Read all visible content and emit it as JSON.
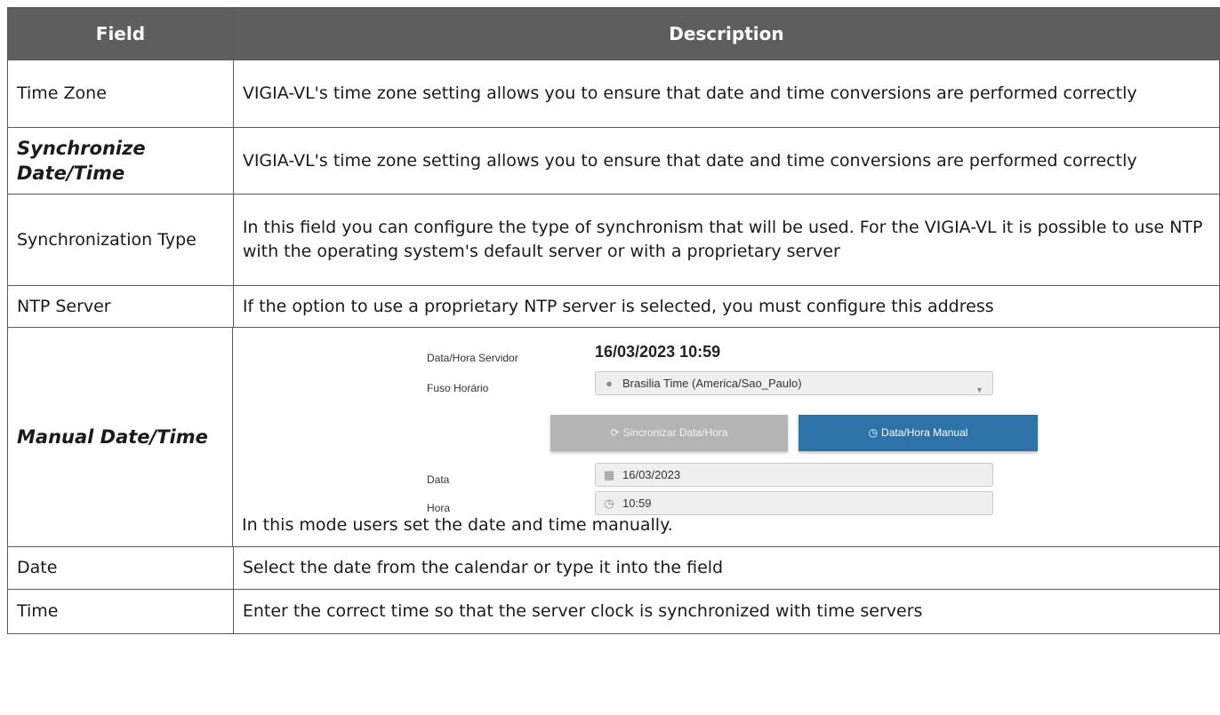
{
  "header": {
    "field": "Field",
    "description": "Description"
  },
  "rows": [
    {
      "field": "Time Zone",
      "description": "VIGIA-VL's time zone setting allows you to ensure that date and time conversions are performed correctly"
    },
    {
      "field": "Synchronize Date/Time",
      "description": "VIGIA-VL's time zone setting allows you to ensure that date and time conversions are performed correctly"
    },
    {
      "field": "Synchronization Type",
      "description": "In this field you can configure the type of synchronism that will be used. For the VIGIA-VL it is possible to use NTP with the operating system's default server or with a proprietary server"
    },
    {
      "field": "NTP Server",
      "description": "If the option to use a proprietary NTP server is selected, you must configure this address"
    },
    {
      "field": "Manual Date/Time",
      "description": "In this mode users set the date and time manually."
    },
    {
      "field": "Date",
      "description": "Select the date from the calendar or type it into the field"
    },
    {
      "field": "Time",
      "description": "Enter the correct time so that the server clock is synchronized with time servers"
    }
  ],
  "screenshot": {
    "server_label": "Data/Hora Servidor",
    "server_value": "16/03/2023 10:59",
    "timezone_label": "Fuso Horário",
    "timezone_value": "Brasilia Time (America/Sao_Paulo)",
    "sync_button": "Sincronizar Data/Hora",
    "manual_button": "Data/Hora Manual",
    "date_label": "Data",
    "date_value": "16/03/2023",
    "time_label": "Hora",
    "time_value": "10:59",
    "colors": {
      "manual_button": "#2e73a8",
      "sync_button": "#b4b4b4"
    },
    "icons": [
      "globe-icon",
      "refresh-icon",
      "clock-icon",
      "calendar-icon",
      "clock-icon"
    ]
  },
  "colors": {
    "header_bg": "#5e5e5e",
    "header_text": "#ffffff",
    "border": "#5b5b5b"
  }
}
